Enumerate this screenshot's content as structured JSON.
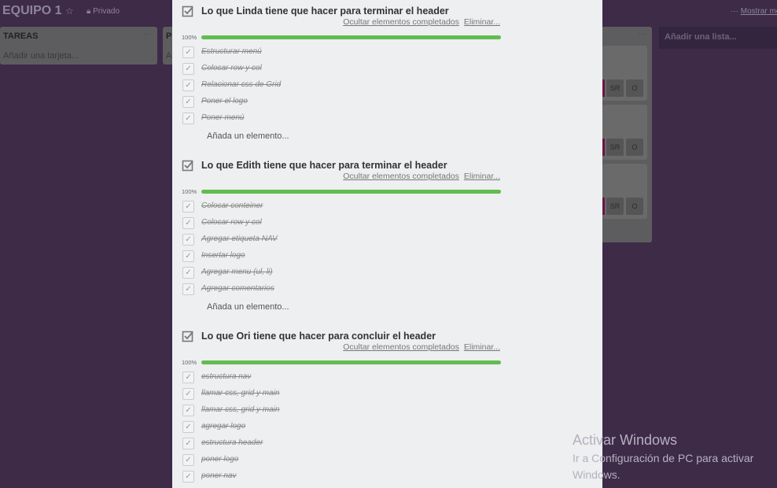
{
  "board": {
    "title": "EQUIPO 1",
    "star_icon": "star-icon",
    "visibility": "Privado",
    "menu_more": "Mostrar menú"
  },
  "lists": [
    {
      "title": "TAREAS",
      "add_card": "Añadir una tarjeta..."
    },
    {
      "title": "P",
      "add_card": "A"
    }
  ],
  "right_list": {
    "cards": [
      {
        "badges": [
          "SR",
          "O"
        ]
      },
      {
        "badges": [
          "SR",
          "O"
        ]
      },
      {
        "badges": [
          "SR",
          "O"
        ]
      }
    ]
  },
  "add_list": "Añadir una lista...",
  "checklists": [
    {
      "title": "Lo que Linda tiene que hacer para terminar el header",
      "hide_completed": "Ocultar elementos completados",
      "delete": "Eliminar...",
      "progress_label": "100%",
      "progress": 100,
      "items": [
        "Estructurar menú",
        "Colocar row y col",
        "Relacionar css de Grid",
        "Poner el logo",
        "Poner menú"
      ],
      "add_item": "Añada un elemento..."
    },
    {
      "title": "Lo que Edith tiene que hacer para terminar el header",
      "hide_completed": "Ocultar elementos completados",
      "delete": "Eliminar...",
      "progress_label": "100%",
      "progress": 100,
      "items": [
        "Colocar conteiner",
        "Colocar row y col",
        "Agregar etiqueta NAV",
        "Insertar logo",
        "Agregar menu (ul, li)",
        "Agregar comentarios"
      ],
      "add_item": "Añada un elemento..."
    },
    {
      "title": "Lo que Ori tiene que hacer para concluir el header",
      "hide_completed": "Ocultar elementos completados",
      "delete": "Eliminar...",
      "progress_label": "100%",
      "progress": 100,
      "items": [
        "estructura nav",
        "llamar css, grid y main",
        "llamar css, grid y main",
        "agregar logo",
        "estructura header",
        "poner logo",
        "poner nav"
      ]
    }
  ],
  "watermark": {
    "title": "Activar Windows",
    "line1": "Ir a Configuración de PC para activar",
    "line2": "Windows."
  },
  "colors": {
    "board_bg": "#3d2b48",
    "progress": "#61bd4f",
    "modal_bg": "#edeff0"
  }
}
